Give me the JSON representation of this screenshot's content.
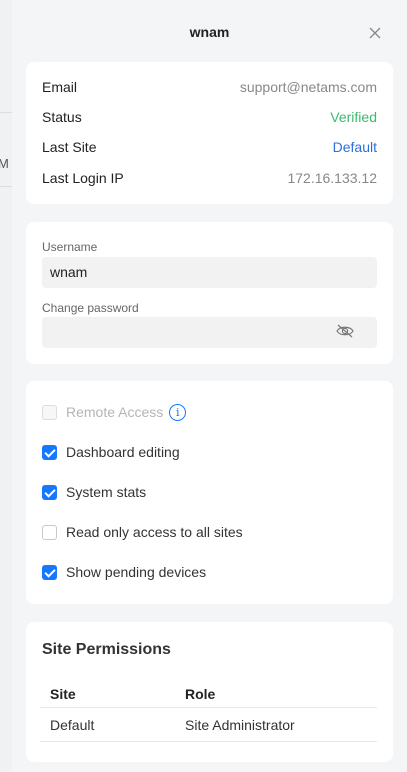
{
  "background_fragment": "M",
  "header": {
    "title": "wnam",
    "close_icon": "close-icon"
  },
  "info": [
    {
      "key": "Email",
      "value": "support@netams.com",
      "color": "#888888"
    },
    {
      "key": "Status",
      "value": "Verified",
      "color": "#3dba6f"
    },
    {
      "key": "Last Site",
      "value": "Default",
      "color": "#2a6fdb"
    },
    {
      "key": "Last Login IP",
      "value": "172.16.133.12",
      "color": "#888888"
    }
  ],
  "credentials": {
    "username_label": "Username",
    "username_value": "wnam",
    "password_label": "Change password",
    "password_value": "",
    "password_icon": "eye-off-icon"
  },
  "permissions": [
    {
      "label": "Remote Access",
      "checked": false,
      "disabled": true,
      "has_info": true
    },
    {
      "label": "Dashboard editing",
      "checked": true,
      "disabled": false
    },
    {
      "label": "System stats",
      "checked": true,
      "disabled": false
    },
    {
      "label": "Read only access to all sites",
      "checked": false,
      "disabled": false
    },
    {
      "label": "Show pending devices",
      "checked": true,
      "disabled": false
    }
  ],
  "site_permissions": {
    "title": "Site Permissions",
    "columns": [
      "Site",
      "Role"
    ],
    "rows": [
      {
        "site": "Default",
        "role": "Site Administrator"
      }
    ]
  },
  "colors": {
    "accent": "#1677ff",
    "verified": "#3dba6f",
    "link": "#2a6fdb"
  }
}
